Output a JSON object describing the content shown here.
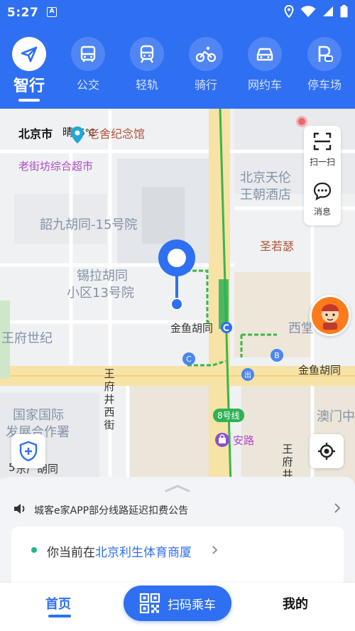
{
  "colors": {
    "primary": "#2f6ff2",
    "accent_green": "#1fb58f",
    "subway_green": "#2eb254",
    "poi_purple": "#b04ac2"
  },
  "status_bar": {
    "time": "5:27",
    "app_badge": "A"
  },
  "nav_tabs": [
    {
      "label": "智行",
      "icon": "paper-plane-icon",
      "active": true
    },
    {
      "label": "公交",
      "icon": "bus-icon",
      "active": false
    },
    {
      "label": "轻轨",
      "icon": "train-icon",
      "active": false
    },
    {
      "label": "骑行",
      "icon": "bike-icon",
      "active": false
    },
    {
      "label": "网约车",
      "icon": "car-icon",
      "active": false
    },
    {
      "label": "停车场",
      "icon": "parking-icon",
      "active": false
    }
  ],
  "map": {
    "city": "北京市",
    "weather": "晴",
    "weather_overlap": "26℃",
    "pois": {
      "memorial": "老舍纪念馆",
      "supermarket": "老街坊综合超市",
      "hotel_line1": "北京天伦",
      "hotel_line2": "王朝酒店",
      "hutong15": "韶九胡同-15号院",
      "sheng": "圣若瑟",
      "xila_line1": "锡拉胡同",
      "xila_line2": "小区13号院",
      "jinyu_station": "金鱼胡同",
      "wangfu": "王府世纪",
      "xitang": "西堂",
      "jinyu_road": "金鱼胡同",
      "wangfujing_street": "王府井西街",
      "line8": "8号线",
      "anlu": "安路",
      "guojia_line1": "国家国际",
      "guojia_line2": "发展合作署",
      "aomen": "澳门中",
      "wangfu_v": "王府井",
      "fifty": "5",
      "dongshan": "东厂胡同"
    },
    "markers": {
      "subway_c": "C",
      "subway_b": "B",
      "exit": "出"
    },
    "tools": [
      {
        "label": "扫一扫",
        "icon": "scan-icon"
      },
      {
        "label": "消息",
        "icon": "message-icon"
      }
    ]
  },
  "sheet": {
    "notice": "城客e家APP部分线路延迟扣费公告",
    "location_prefix": "你当前在",
    "location_place": "北京利生体育商厦"
  },
  "bottom_nav": {
    "home": "首页",
    "scan": "扫码乘车",
    "mine": "我的"
  }
}
